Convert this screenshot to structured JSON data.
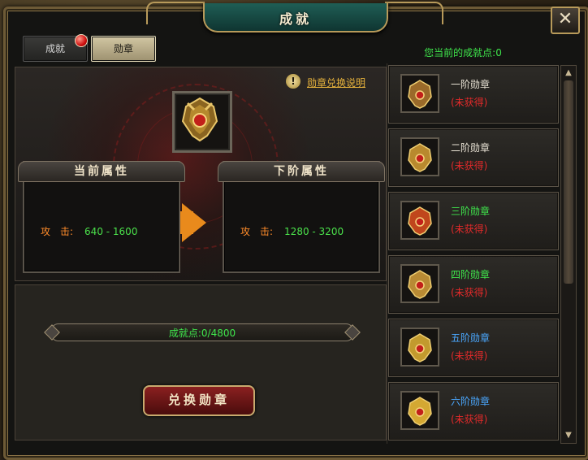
{
  "window": {
    "title": "成就"
  },
  "close": {
    "glyph": "✕"
  },
  "tabs": [
    {
      "label": "成就",
      "selected": false,
      "has_alert": true
    },
    {
      "label": "勋章",
      "selected": true
    }
  ],
  "points_label": "您当前的成就点:0",
  "help": {
    "glyph": "!",
    "link_label": "勋章兑换说明"
  },
  "current_attr": {
    "header": "当前属性",
    "stat_label": "攻　击:",
    "stat_value": "640 - 1600"
  },
  "next_attr": {
    "header": "下阶属性",
    "stat_label": "攻　击:",
    "stat_value": "1280 - 3200"
  },
  "progress": {
    "text": "成就点:0/4800",
    "current": 0,
    "max": 4800
  },
  "exchange_button": "兑换勋章",
  "medals": [
    {
      "name": "一阶勋章",
      "status": "(未获得)",
      "name_color": "#e8e2d4",
      "icon": "medal-tier1-icon"
    },
    {
      "name": "二阶勋章",
      "status": "(未获得)",
      "name_color": "#e8e2d4",
      "icon": "medal-tier2-icon"
    },
    {
      "name": "三阶勋章",
      "status": "(未获得)",
      "name_color": "#3fe64c",
      "icon": "medal-tier3-icon"
    },
    {
      "name": "四阶勋章",
      "status": "(未获得)",
      "name_color": "#3fe64c",
      "icon": "medal-tier4-icon"
    },
    {
      "name": "五阶勋章",
      "status": "(未获得)",
      "name_color": "#4aa8ff",
      "icon": "medal-tier5-icon"
    },
    {
      "name": "六阶勋章",
      "status": "(未获得)",
      "name_color": "#4aa8ff",
      "icon": "medal-tier6-icon"
    }
  ],
  "colors": {
    "green_text": "#3fe64c",
    "orange_label": "#ff8c2a",
    "red_status": "#e32a2a",
    "gold_link": "#e6b23c"
  }
}
